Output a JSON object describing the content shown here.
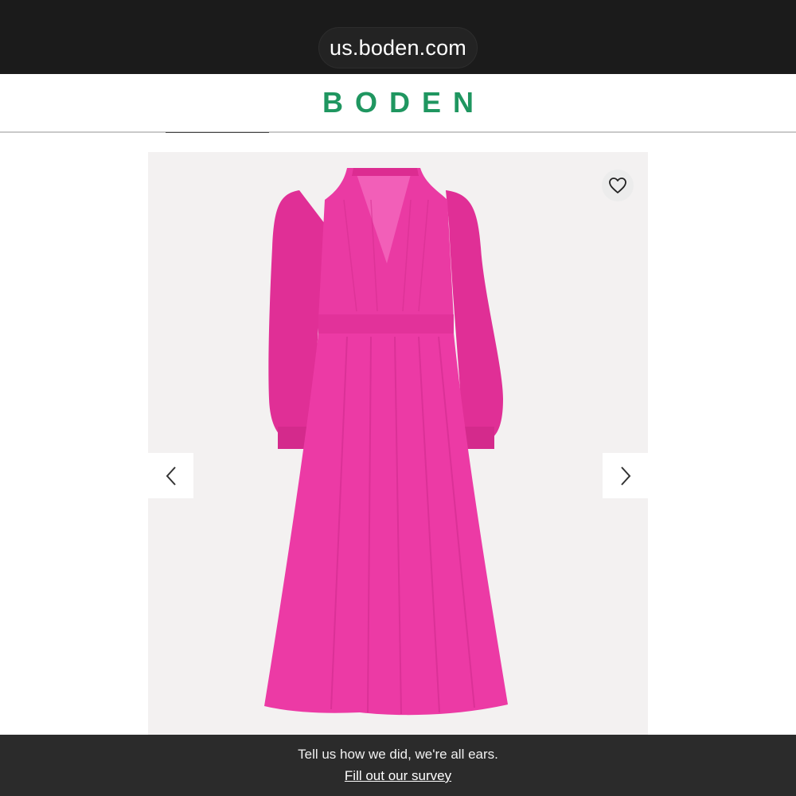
{
  "browser": {
    "url": "us.boden.com"
  },
  "header": {
    "logo": "BODEN",
    "brand_color": "#1f9660"
  },
  "product": {
    "image_alt": "Pink long-sleeve midi dress",
    "dress_color": "#e8339f"
  },
  "icons": {
    "wishlist": "heart-icon",
    "prev": "chevron-left-icon",
    "next": "chevron-right-icon"
  },
  "survey": {
    "text": "Tell us how we did, we're all ears.",
    "link": "Fill out our survey"
  }
}
